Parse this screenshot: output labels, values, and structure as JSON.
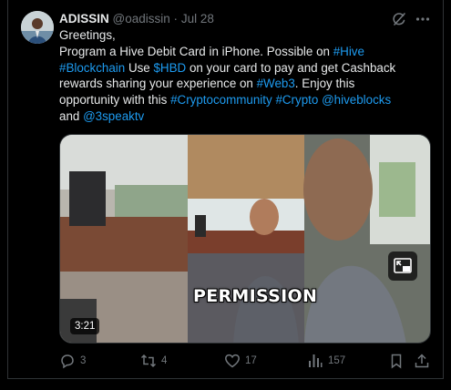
{
  "tweet": {
    "author_name": "ADISSIN",
    "author_handle": "@oadissin",
    "separator": "·",
    "date": "Jul 28",
    "lines": [
      [
        {
          "t": "Greetings,",
          "link": false
        }
      ],
      [
        {
          "t": "Program a Hive Debit Card in iPhone. Possible on ",
          "link": false
        },
        {
          "t": "#Hive",
          "link": true
        }
      ],
      [
        {
          "t": "#Blockchain",
          "link": true
        },
        {
          "t": " Use ",
          "link": false
        },
        {
          "t": "$HBD",
          "link": true
        },
        {
          "t": " on your card to pay and get Cashback",
          "link": false
        }
      ],
      [
        {
          "t": "rewards sharing your experience on ",
          "link": false
        },
        {
          "t": "#Web3",
          "link": true
        },
        {
          "t": ". Enjoy this",
          "link": false
        }
      ],
      [
        {
          "t": "opportunity with this ",
          "link": false
        },
        {
          "t": "#Cryptocommunity",
          "link": true
        },
        {
          "t": " ",
          "link": false
        },
        {
          "t": "#Crypto",
          "link": true
        },
        {
          "t": " ",
          "link": false
        },
        {
          "t": "@hiveblocks",
          "link": true
        }
      ],
      [
        {
          "t": "and ",
          "link": false
        },
        {
          "t": "@3speaktv",
          "link": true
        }
      ]
    ],
    "video": {
      "duration": "3:21",
      "caption": "PERMISSION"
    },
    "stats": {
      "replies": "3",
      "reposts": "4",
      "likes": "17",
      "views": "157"
    }
  },
  "colors": {
    "background": "#000000",
    "text": "#e7e9ea",
    "muted": "#71767b",
    "link": "#1d9bf0",
    "border": "#2f3336"
  },
  "icons": [
    "grok-icon",
    "more-icon",
    "reply-icon",
    "repost-icon",
    "like-icon",
    "views-icon",
    "bookmark-icon",
    "share-icon",
    "picture-in-picture-icon"
  ]
}
